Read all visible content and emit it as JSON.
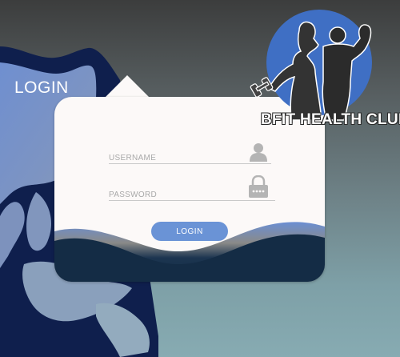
{
  "heading": "LOGIN",
  "form": {
    "username_placeholder": "USERNAME",
    "password_placeholder": "PASSWORD",
    "login_button": "LOGIN"
  },
  "logo": {
    "club_name": "BFIT HEALTH CLUB"
  },
  "colors": {
    "accent": "#6a93d6",
    "navy": "#0f1f4d",
    "card": "#fcf9f8",
    "logo_circle": "#3f6fc4"
  },
  "icons": [
    "user-icon",
    "lock-icon",
    "dumbbell-icon"
  ]
}
